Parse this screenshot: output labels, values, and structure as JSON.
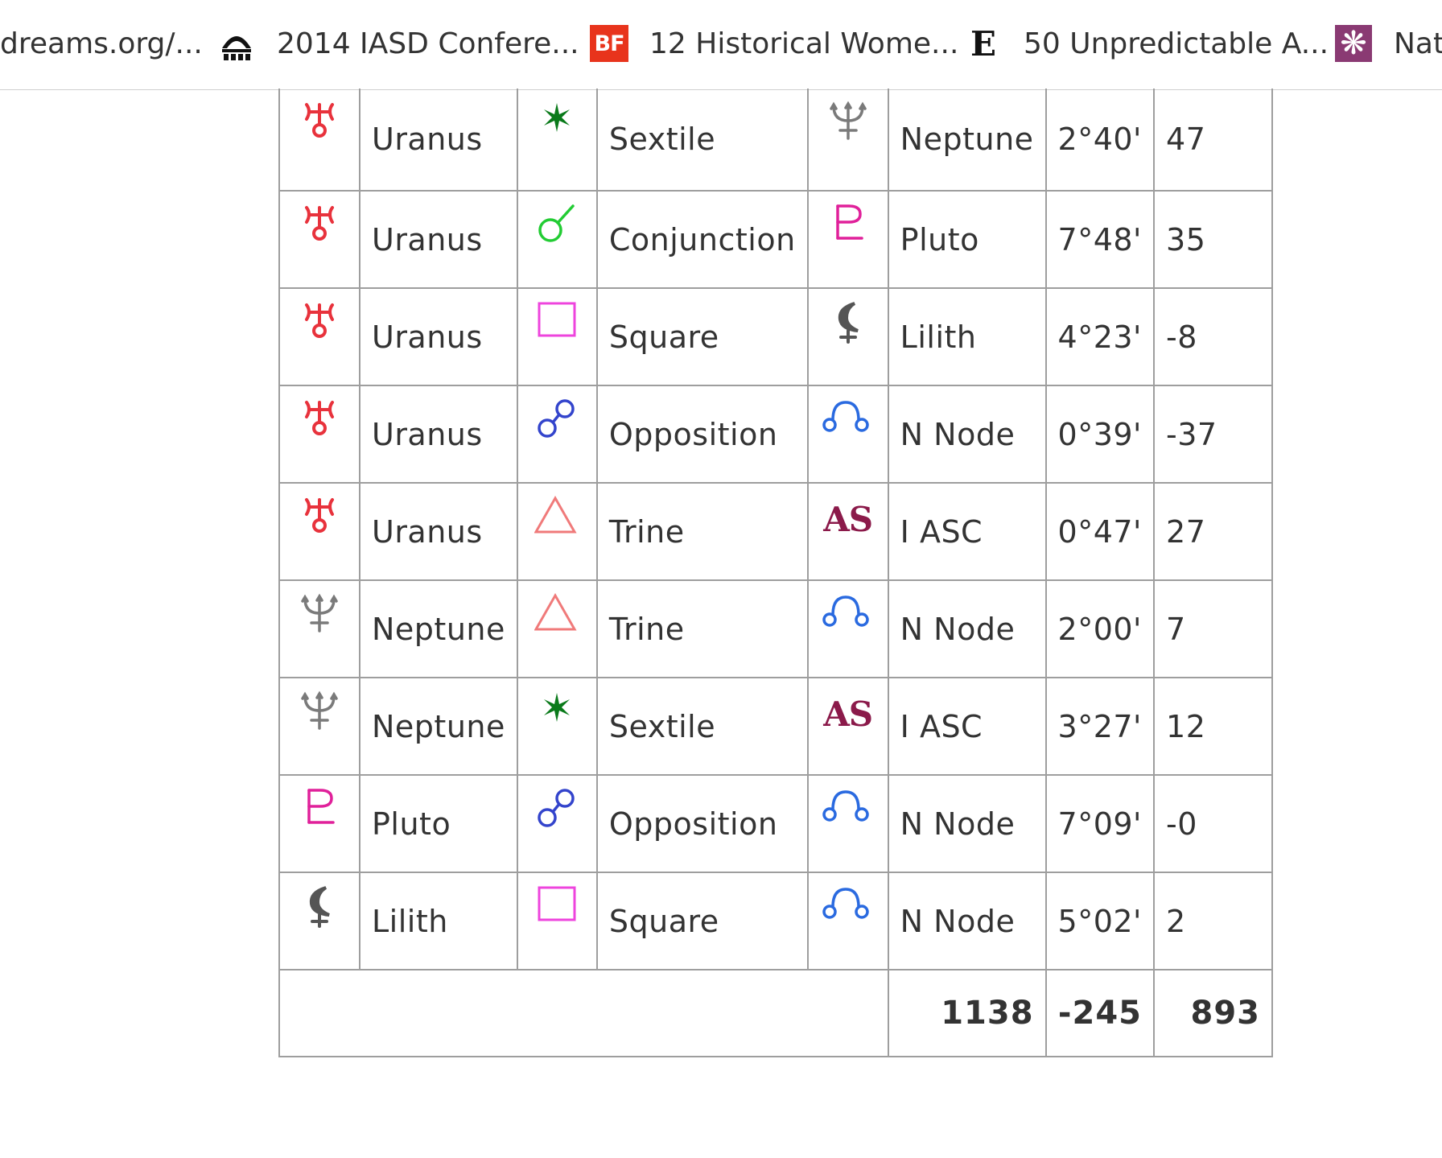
{
  "bookmarks": [
    {
      "label": "dreams.org/...",
      "icon": "none"
    },
    {
      "label": "2014 IASD Confere...",
      "icon": "iasd-logo-icon"
    },
    {
      "label": "12 Historical Wome...",
      "icon": "bf-badge-icon",
      "badge_text": "BF",
      "color": "#e8341c"
    },
    {
      "label": "50 Unpredictable A...",
      "icon": "e-letter-icon",
      "badge_text": "E"
    },
    {
      "label": "Natu",
      "icon": "snowflake-icon",
      "color": "#8a3a73"
    }
  ],
  "colors": {
    "uranus": "#e8323c",
    "neptune": "#7a7a7a",
    "pluto": "#e0209a",
    "lilith": "#555555",
    "node": "#2a6ae0",
    "asc": "#8b1a4a",
    "sextile": "#0a7a1a",
    "conjunction": "#22cc33",
    "square": "#ee44dd",
    "opposition": "#3344cc",
    "trine": "#f07a7a"
  },
  "aspects": [
    {
      "planet1_icon": "uranus-icon",
      "planet1": "Uranus",
      "aspect_icon": "sextile-icon",
      "aspect": "Sextile",
      "planet2_icon": "neptune-icon",
      "planet2": "Neptune",
      "orb": "2°40'",
      "score": "47"
    },
    {
      "planet1_icon": "uranus-icon",
      "planet1": "Uranus",
      "aspect_icon": "conjunction-icon",
      "aspect": "Conjunction",
      "planet2_icon": "pluto-icon",
      "planet2": "Pluto",
      "orb": "7°48'",
      "score": "35"
    },
    {
      "planet1_icon": "uranus-icon",
      "planet1": "Uranus",
      "aspect_icon": "square-icon",
      "aspect": "Square",
      "planet2_icon": "lilith-icon",
      "planet2": "Lilith",
      "orb": "4°23'",
      "score": "-8"
    },
    {
      "planet1_icon": "uranus-icon",
      "planet1": "Uranus",
      "aspect_icon": "opposition-icon",
      "aspect": "Opposition",
      "planet2_icon": "north-node-icon",
      "planet2": "N Node",
      "orb": "0°39'",
      "score": "-37"
    },
    {
      "planet1_icon": "uranus-icon",
      "planet1": "Uranus",
      "aspect_icon": "trine-icon",
      "aspect": "Trine",
      "planet2_icon": "ascendant-icon",
      "planet2": "I ASC",
      "orb": "0°47'",
      "score": "27",
      "asc_text": "AS"
    },
    {
      "planet1_icon": "neptune-icon",
      "planet1": "Neptune",
      "aspect_icon": "trine-icon",
      "aspect": "Trine",
      "planet2_icon": "north-node-icon",
      "planet2": "N Node",
      "orb": "2°00'",
      "score": "7"
    },
    {
      "planet1_icon": "neptune-icon",
      "planet1": "Neptune",
      "aspect_icon": "sextile-icon",
      "aspect": "Sextile",
      "planet2_icon": "ascendant-icon",
      "planet2": "I ASC",
      "orb": "3°27'",
      "score": "12",
      "asc_text": "AS"
    },
    {
      "planet1_icon": "pluto-icon",
      "planet1": "Pluto",
      "aspect_icon": "opposition-icon",
      "aspect": "Opposition",
      "planet2_icon": "north-node-icon",
      "planet2": "N Node",
      "orb": "7°09'",
      "score": "-0"
    },
    {
      "planet1_icon": "lilith-icon",
      "planet1": "Lilith",
      "aspect_icon": "square-icon",
      "aspect": "Square",
      "planet2_icon": "north-node-icon",
      "planet2": "N Node",
      "orb": "5°02'",
      "score": "2"
    }
  ],
  "totals": {
    "positive": "1138",
    "negative": "-245",
    "net": "893"
  }
}
